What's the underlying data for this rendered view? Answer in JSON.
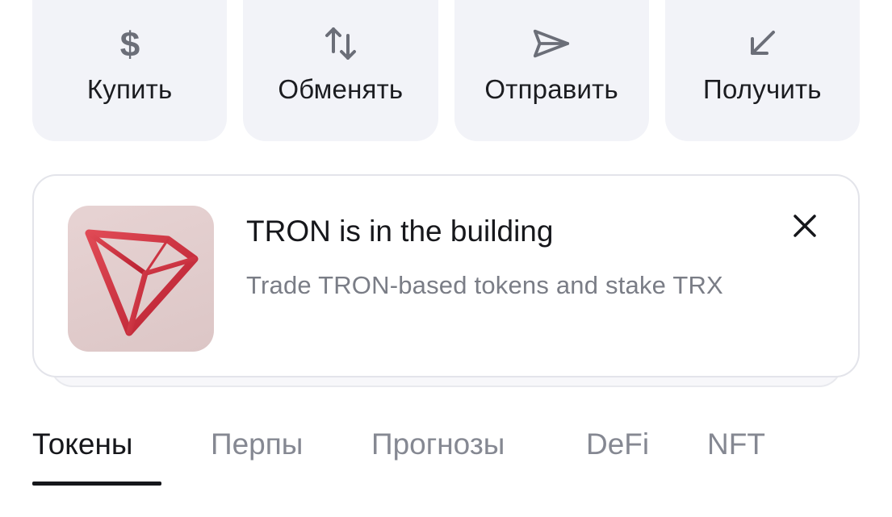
{
  "actions": [
    {
      "label": "Купить",
      "icon": "dollar-icon"
    },
    {
      "label": "Обменять",
      "icon": "swap-arrows-icon"
    },
    {
      "label": "Отправить",
      "icon": "send-icon"
    },
    {
      "label": "Получить",
      "icon": "receive-arrow-icon"
    }
  ],
  "banner": {
    "title": "TRON is in the building",
    "subtitle": "Trade TRON-based tokens and stake TRX",
    "image_icon": "tron-logo-icon",
    "close_icon": "close-icon"
  },
  "tabs": [
    {
      "label": "Токены",
      "active": true
    },
    {
      "label": "Перпы",
      "active": false
    },
    {
      "label": "Прогнозы",
      "active": false
    },
    {
      "label": "DeFi",
      "active": false
    },
    {
      "label": "NFT",
      "active": false
    }
  ],
  "colors": {
    "tile_bg": "#f2f3f8",
    "icon_gray": "#6b6e78",
    "text_primary": "#16171b",
    "text_secondary": "#7a7d86",
    "tron_red": "#d3303f"
  }
}
